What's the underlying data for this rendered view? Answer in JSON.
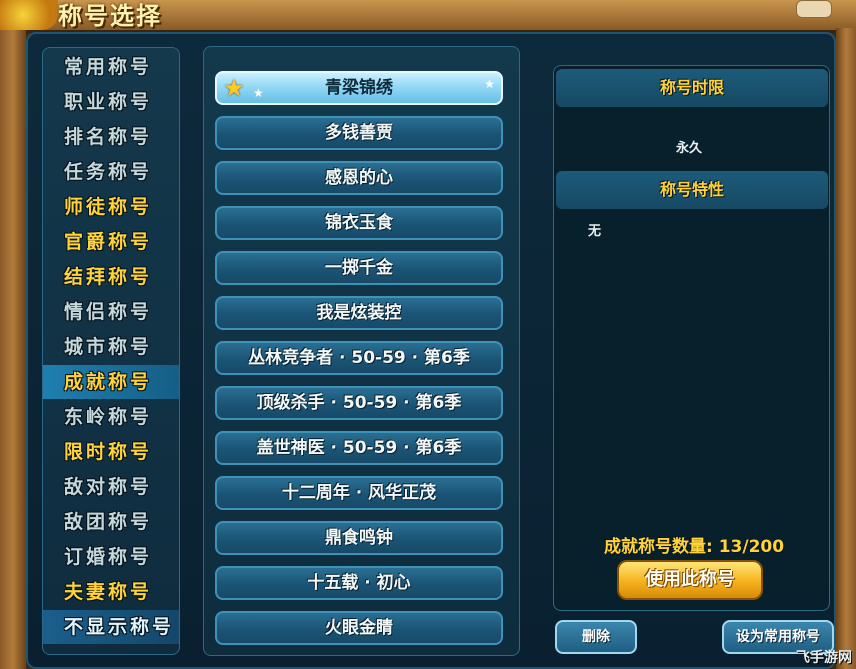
{
  "window": {
    "title": "称号选择"
  },
  "sidebar": {
    "items": [
      {
        "label": "常用称号",
        "style": "normal"
      },
      {
        "label": "职业称号",
        "style": "normal"
      },
      {
        "label": "排名称号",
        "style": "normal"
      },
      {
        "label": "任务称号",
        "style": "normal"
      },
      {
        "label": "师徒称号",
        "style": "gold"
      },
      {
        "label": "官爵称号",
        "style": "gold"
      },
      {
        "label": "结拜称号",
        "style": "gold"
      },
      {
        "label": "情侣称号",
        "style": "normal"
      },
      {
        "label": "城市称号",
        "style": "normal"
      },
      {
        "label": "成就称号",
        "style": "active"
      },
      {
        "label": "东岭称号",
        "style": "normal"
      },
      {
        "label": "限时称号",
        "style": "gold"
      },
      {
        "label": "敌对称号",
        "style": "normal"
      },
      {
        "label": "敌团称号",
        "style": "normal"
      },
      {
        "label": "订婚称号",
        "style": "normal"
      },
      {
        "label": "夫妻称号",
        "style": "gold"
      },
      {
        "label": "不显示称号",
        "style": "blue"
      }
    ]
  },
  "titles": {
    "selected_index": 0,
    "items": [
      "青梁锦绣",
      "多钱善贾",
      "感恩的心",
      "锦衣玉食",
      "一掷千金",
      "我是炫装控",
      "丛林竞争者 · 50-59 · 第6季",
      "顶级杀手 · 50-59 · 第6季",
      "盖世神医 · 50-59 · 第6季",
      "十二周年 · 风华正茂",
      "鼎食鸣钟",
      "十五载 · 初心",
      "火眼金睛"
    ]
  },
  "detail": {
    "limit_header": "称号时限",
    "limit_value": "永久",
    "feature_header": "称号特性",
    "feature_value": "无",
    "count_label": "成就称号数量: 13/200",
    "use_button": "使用此称号"
  },
  "footer": {
    "delete_button": "删除",
    "set_common_button": "设为常用称号"
  },
  "watermark": "飞手游网",
  "colors": {
    "gold": "#ffd339",
    "panel": "#0d2a3c",
    "selected": "#8fd6f5"
  }
}
